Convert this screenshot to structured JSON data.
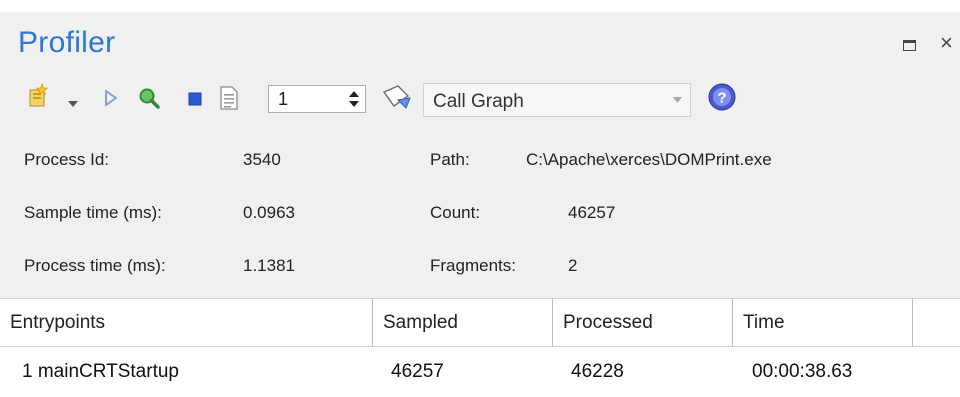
{
  "window": {
    "title": "Profiler",
    "close_glyph": "×"
  },
  "toolbar": {
    "spinner_value": "1",
    "view_value": "Call Graph"
  },
  "process_info": {
    "process_id_label": "Process Id:",
    "process_id_value": "3540",
    "sample_time_label": "Sample time (ms):",
    "sample_time_value": "0.0963",
    "process_time_label": "Process time (ms):",
    "process_time_value": "1.1381",
    "path_label": "Path:",
    "path_value": "C:\\Apache\\xerces\\DOMPrint.exe",
    "count_label": "Count:",
    "count_value": "46257",
    "fragments_label": "Fragments:",
    "fragments_value": "2"
  },
  "table": {
    "headers": [
      "Entrypoints",
      "Sampled",
      "Processed",
      "Time"
    ],
    "rows": [
      {
        "entrypoint": "1 mainCRTStartup",
        "sampled": "46257",
        "processed": "46228",
        "time": "00:00:38.63"
      }
    ]
  },
  "colors": {
    "title": "#2e75d6",
    "panel": "#f0f0f0",
    "icon_blue": "#2c59d6",
    "icon_green": "#2fa84f"
  },
  "icons": [
    "new-icon",
    "dropdown-arrow-icon",
    "play-icon",
    "search-icon",
    "stop-icon",
    "document-icon",
    "attach-process-icon",
    "help-icon"
  ]
}
